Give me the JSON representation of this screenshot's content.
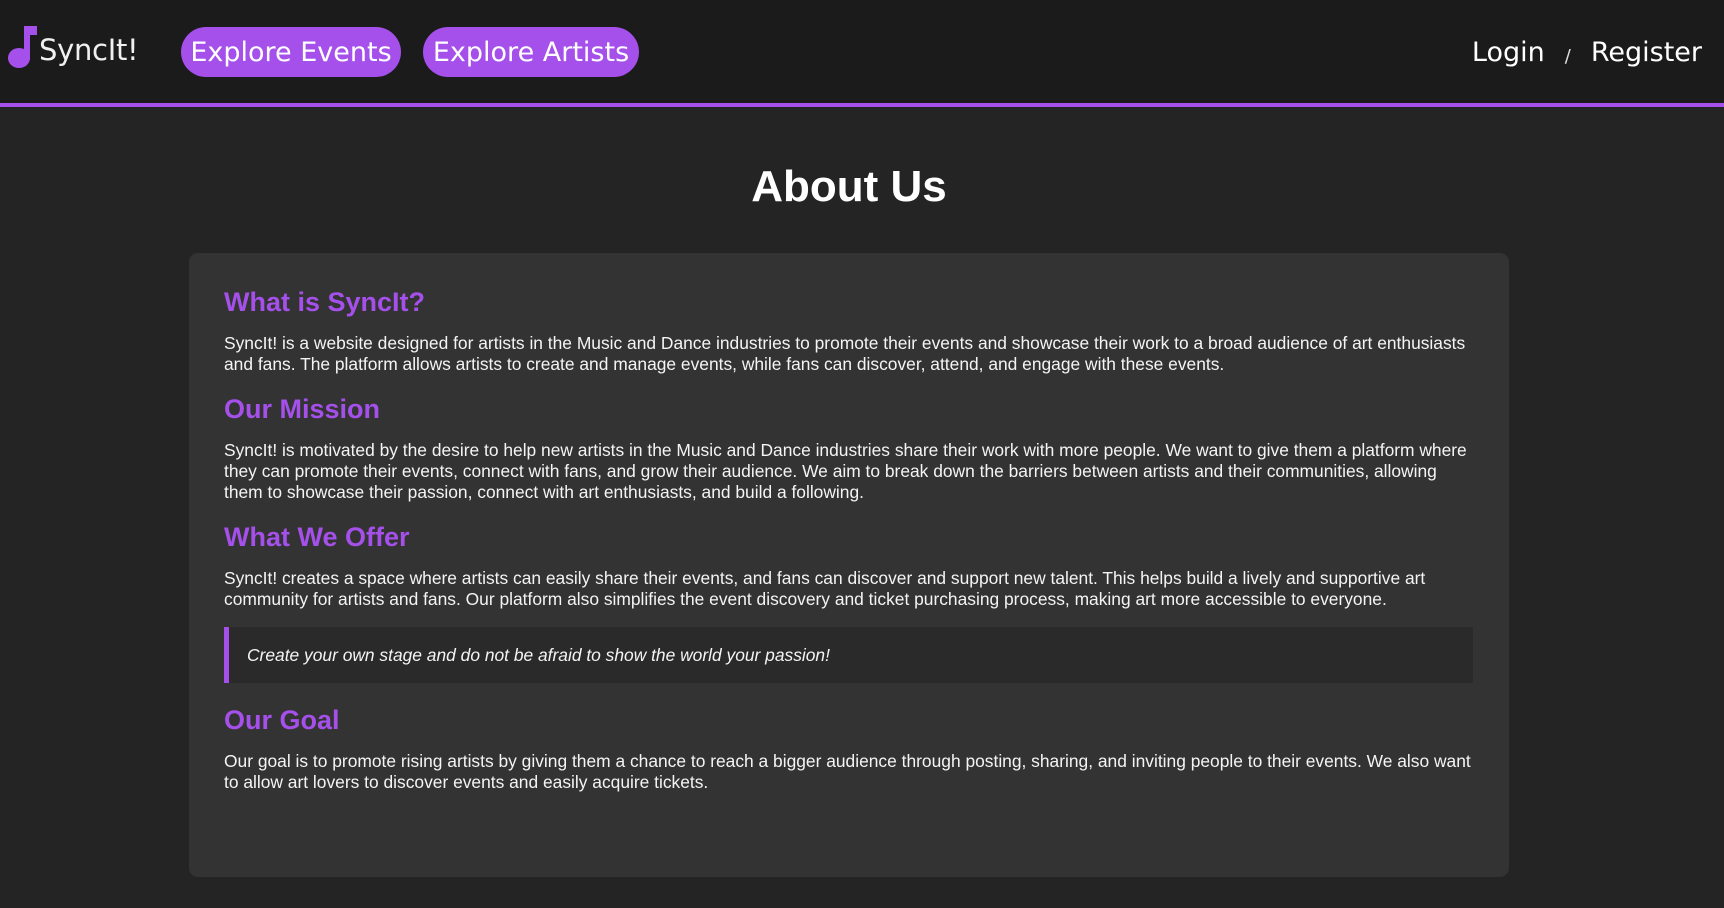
{
  "nav": {
    "logo_text": "SyncIt!",
    "logo_icon": "music-note-icon",
    "explore_events": "Explore Events",
    "explore_artists": "Explore Artists",
    "login": "Login",
    "separator": "/",
    "register": "Register"
  },
  "colors": {
    "accent": "#a550ea",
    "background": "#242424",
    "navbar": "#1b1b1b",
    "card": "#333333"
  },
  "page": {
    "title": "About Us"
  },
  "sections": [
    {
      "heading": "What is SyncIt?",
      "body": "SyncIt! is a website designed for artists in the Music and Dance industries to promote their events and showcase their work to a broad audience of art enthusiasts and fans. The platform allows artists to create and manage events, while fans can discover, attend, and engage with these events."
    },
    {
      "heading": "Our Mission",
      "body": "SyncIt! is motivated by the desire to help new artists in the Music and Dance industries share their work with more people. We want to give them a platform where they can promote their events, connect with fans, and grow their audience. We aim to break down the barriers between artists and their communities, allowing them to showcase their passion, connect with art enthusiasts, and build a following."
    },
    {
      "heading": "What We Offer",
      "body": "SyncIt! creates a space where artists can easily share their events, and fans can discover and support new talent. This helps build a lively and supportive art community for artists and fans. Our platform also simplifies the event discovery and ticket purchasing process, making art more accessible to everyone."
    },
    {
      "heading": "Our Goal",
      "body": "Our goal is to promote rising artists by giving them a chance to reach a bigger audience through posting, sharing, and inviting people to their events. We also want to allow art lovers to discover events and easily acquire tickets."
    }
  ],
  "quote": "Create your own stage and do not be afraid to show the world your passion!"
}
